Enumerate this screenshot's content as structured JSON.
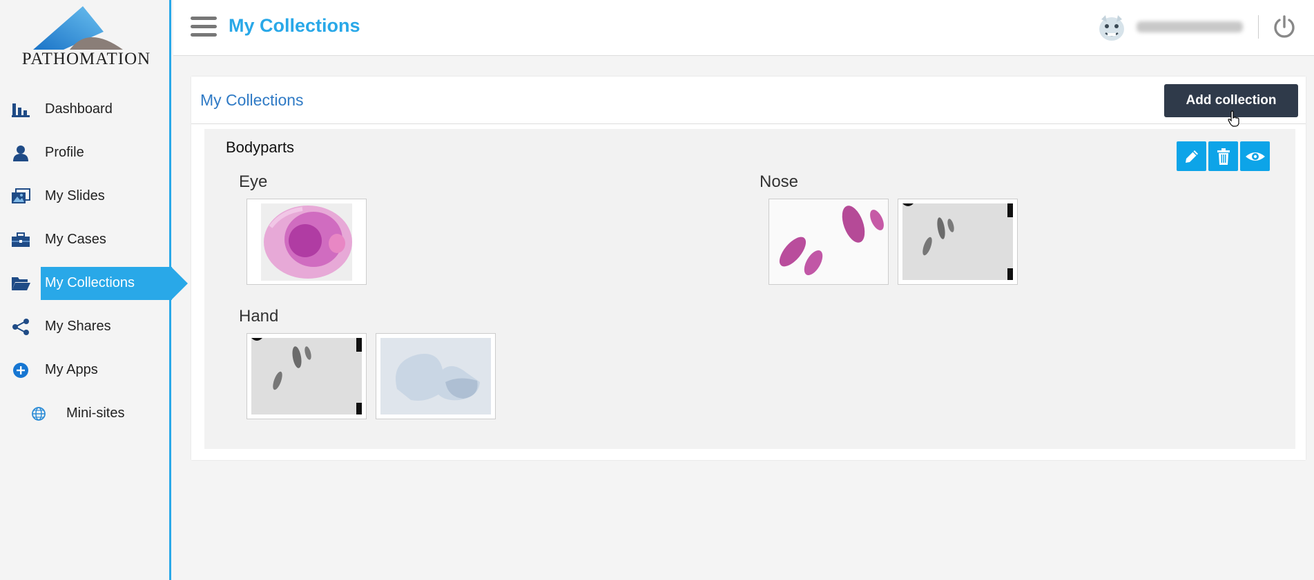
{
  "app": {
    "logo_text": "PATHOMATION"
  },
  "sidebar": {
    "items": [
      {
        "label": "Dashboard"
      },
      {
        "label": "Profile"
      },
      {
        "label": "My Slides"
      },
      {
        "label": "My Cases"
      },
      {
        "label": "My Collections"
      },
      {
        "label": "My Shares"
      },
      {
        "label": "My Apps"
      },
      {
        "label": "Mini-sites"
      }
    ],
    "active_index": 4
  },
  "header": {
    "title": "My Collections",
    "user_name": "••••••••••"
  },
  "panel": {
    "title": "My Collections",
    "add_button_label": "Add collection",
    "collection": {
      "name": "Bodyparts",
      "actions": [
        "edit-icon",
        "trash-icon",
        "eye-icon"
      ],
      "groups": [
        {
          "name": "Eye"
        },
        {
          "name": "Nose"
        },
        {
          "name": "Hand"
        }
      ]
    }
  },
  "colors": {
    "accent": "#29a8e8",
    "title_blue": "#2f7ac5",
    "button_dark": "#2f3a4a",
    "action_blue": "#0da4e8"
  }
}
